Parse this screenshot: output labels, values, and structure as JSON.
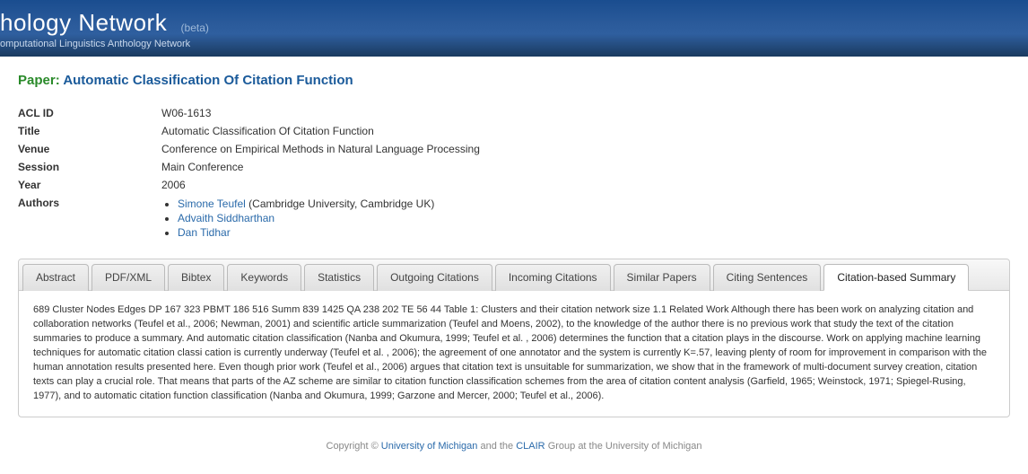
{
  "header": {
    "title": "hology Network",
    "beta": "(beta)",
    "subtitle": "omputational Linguistics Anthology Network"
  },
  "paper": {
    "label": "Paper:",
    "title": "Automatic Classification Of Citation Function"
  },
  "meta": {
    "acl_id_key": "ACL ID",
    "acl_id_val": "W06-1613",
    "title_key": "Title",
    "title_val": "Automatic Classification Of Citation Function",
    "venue_key": "Venue",
    "venue_val": "Conference on Empirical Methods in Natural Language Processing",
    "session_key": "Session",
    "session_val": "Main Conference",
    "year_key": "Year",
    "year_val": "2006",
    "authors_key": "Authors"
  },
  "authors": [
    {
      "name": "Simone Teufel",
      "affil": " (Cambridge University, Cambridge UK)"
    },
    {
      "name": "Advaith Siddharthan",
      "affil": ""
    },
    {
      "name": "Dan Tidhar",
      "affil": ""
    }
  ],
  "tabs": [
    {
      "label": "Abstract"
    },
    {
      "label": "PDF/XML"
    },
    {
      "label": "Bibtex"
    },
    {
      "label": "Keywords"
    },
    {
      "label": "Statistics"
    },
    {
      "label": "Outgoing Citations"
    },
    {
      "label": "Incoming Citations"
    },
    {
      "label": "Similar Papers"
    },
    {
      "label": "Citing Sentences"
    },
    {
      "label": "Citation-based Summary"
    }
  ],
  "active_tab_index": 9,
  "tab_body": "689 Cluster Nodes Edges DP 167 323 PBMT 186 516 Summ 839 1425 QA 238 202 TE 56 44 Table 1: Clusters and their citation network size 1.1 Related Work Although there has been work on analyzing citation and collaboration networks (Teufel et al., 2006; Newman, 2001) and scientific article summarization (Teufel and Moens, 2002), to the knowledge of the author there is no previous work that study the text of the citation summaries to produce a summary. And automatic citation classification (Nanba and Okumura, 1999; Teufel et al. , 2006) determines the function that a citation plays in the discourse. Work on applying machine learning techniques for automatic citation classi cation is currently underway (Teufel et al. , 2006); the agreement of one annotator and the system is currently K=.57, leaving plenty of room for improvement in comparison with the human annotation results presented here. Even though prior work (Teufel et al., 2006) argues that citation text is unsuitable for summarization, we show that in the framework of multi-document survey creation, citation texts can play a crucial role. That means that parts of the AZ scheme are similar to citation function classification schemes from the area of citation content analysis (Garfield, 1965; Weinstock, 1971; Spiegel-Rusing, 1977), and to automatic citation function classification (Nanba and Okumura, 1999; Garzone and Mercer, 2000; Teufel et al., 2006).",
  "footer": {
    "prefix": "Copyright © ",
    "link1": "University of Michigan",
    "mid": " and the ",
    "link2": "CLAIR",
    "suffix": " Group at the University of Michigan"
  }
}
